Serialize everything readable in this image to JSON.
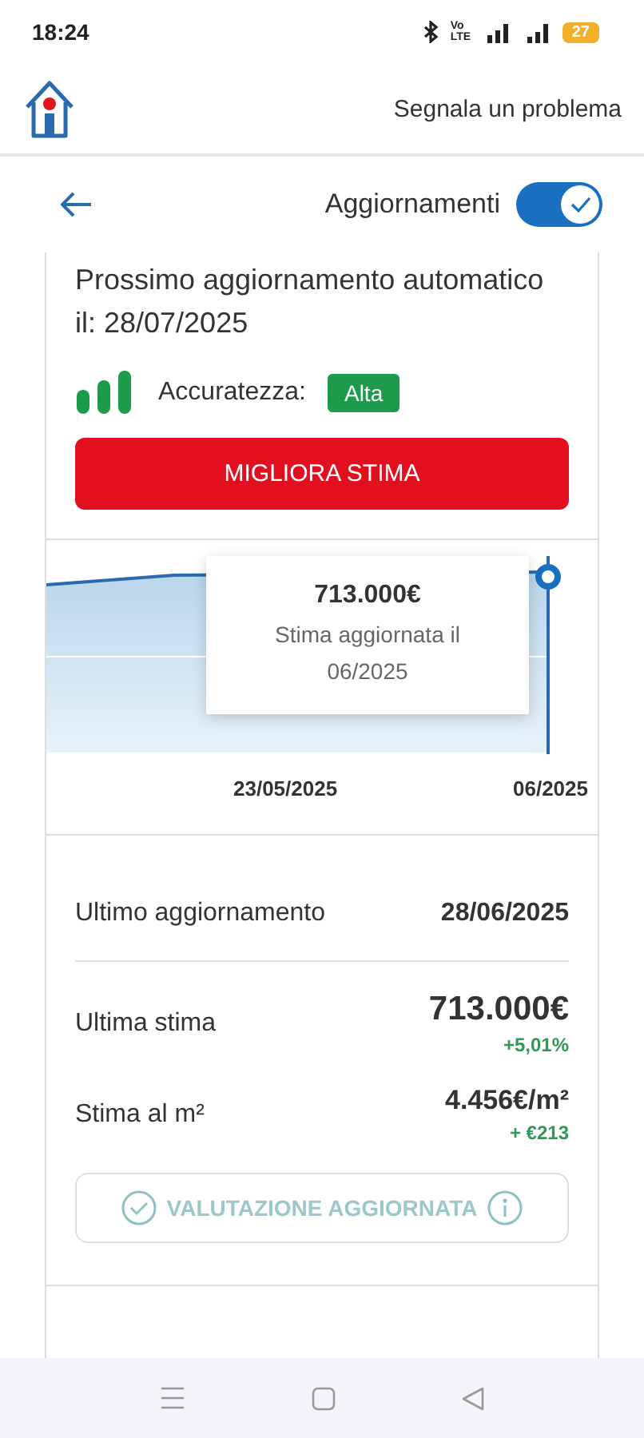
{
  "status_bar": {
    "time": "18:24",
    "network": "Vo LTE",
    "battery": "27"
  },
  "header": {
    "link": "Segnala un problema"
  },
  "nav": {
    "title": "Aggiornamenti",
    "toggle_on": true
  },
  "next_update": {
    "text": "Prossimo aggiornamento automatico il: 28/07/2025",
    "accuracy_label": "Accuratezza:",
    "accuracy_badge": "Alta",
    "button": "MIGLIORA STIMA"
  },
  "chart": {
    "tooltip_value": "713.000€",
    "tooltip_text": "Stima aggiornata il 06/2025",
    "x_labels": [
      "23/05/2025",
      "06/2025"
    ]
  },
  "stats": {
    "last_update_label": "Ultimo aggiornamento",
    "last_update_value": "28/06/2025",
    "rows": [
      {
        "label": "Ultima stima",
        "value": "713.000€",
        "delta": "+5,01%",
        "kind": "large"
      },
      {
        "label": "Stima al m²",
        "value": "4.456€/m²",
        "delta": "+ €213",
        "kind": "small"
      }
    ],
    "badge": "VALUTAZIONE AGGIORNATA"
  }
}
